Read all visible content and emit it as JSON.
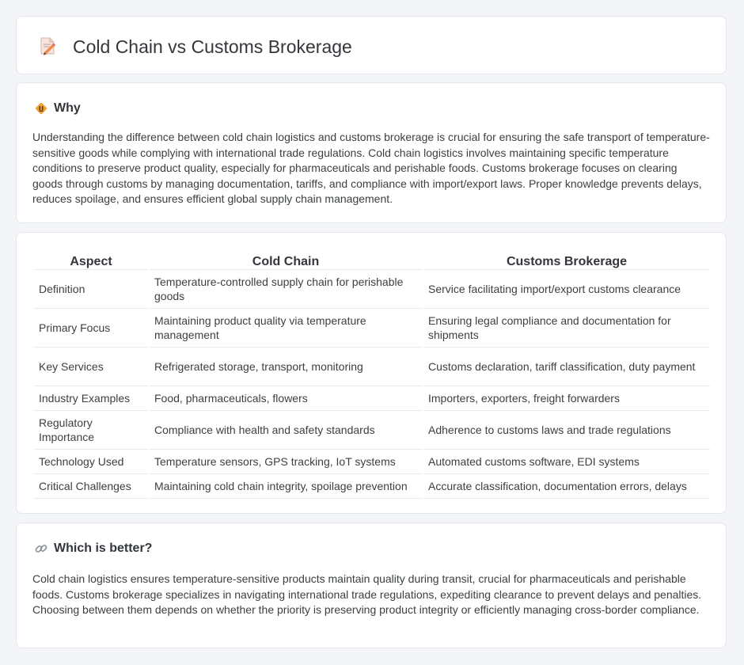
{
  "header": {
    "title": "Cold Chain vs Customs Brokerage",
    "icon": "document-pencil-icon"
  },
  "why": {
    "heading": "Why",
    "icon": "diamond-warning-icon",
    "text": "Understanding the difference between cold chain logistics and customs brokerage is crucial for ensuring the safe transport of temperature-sensitive goods while complying with international trade regulations. Cold chain logistics involves maintaining specific temperature conditions to preserve product quality, especially for pharmaceuticals and perishable foods. Customs brokerage focuses on clearing goods through customs by managing documentation, tariffs, and compliance with import/export laws. Proper knowledge prevents delays, reduces spoilage, and ensures efficient global supply chain management."
  },
  "comparison": {
    "columns": [
      "Aspect",
      "Cold Chain",
      "Customs Brokerage"
    ],
    "rows": [
      [
        "Definition",
        "Temperature-controlled supply chain for perishable goods",
        "Service facilitating import/export customs clearance"
      ],
      [
        "Primary Focus",
        "Maintaining product quality via temperature management",
        "Ensuring legal compliance and documentation for shipments"
      ],
      [
        "Key Services",
        "Refrigerated storage, transport, monitoring",
        "Customs declaration, tariff classification, duty payment"
      ],
      [
        "Industry Examples",
        "Food, pharmaceuticals, flowers",
        "Importers, exporters, freight forwarders"
      ],
      [
        "Regulatory Importance",
        "Compliance with health and safety standards",
        "Adherence to customs laws and trade regulations"
      ],
      [
        "Technology Used",
        "Temperature sensors, GPS tracking, IoT systems",
        "Automated customs software, EDI systems"
      ],
      [
        "Critical Challenges",
        "Maintaining cold chain integrity, spoilage prevention",
        "Accurate classification, documentation errors, delays"
      ]
    ]
  },
  "better": {
    "heading": "Which is better?",
    "icon": "link-icon",
    "text": "Cold chain logistics ensures temperature-sensitive products maintain quality during transit, crucial for pharmaceuticals and perishable foods. Customs brokerage specializes in navigating international trade regulations, expediting clearance to prevent delays and penalties. Choosing between them depends on whether the priority is preserving product integrity or efficiently managing cross-border compliance."
  }
}
